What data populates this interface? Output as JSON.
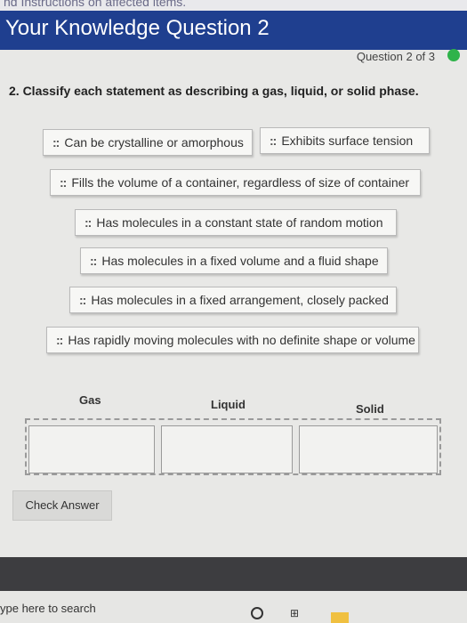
{
  "top_strip_text": "nd Instructions on affected items.",
  "header": {
    "title": "Your Knowledge Question 2"
  },
  "question_counter": "Question 2 of 3",
  "question_text": "2. Classify each statement as describing a gas, liquid, or solid phase.",
  "drag_items": [
    "Can be crystalline or amorphous",
    "Exhibits surface tension",
    "Fills the volume of a container, regardless of size of container",
    "Has molecules in a constant state of random motion",
    "Has molecules in a fixed volume and a fluid shape",
    "Has molecules in a fixed arrangement, closely packed",
    "Has rapidly moving molecules with no definite shape or volume"
  ],
  "grip_glyph": "::",
  "categories": [
    "Gas",
    "Liquid",
    "Solid"
  ],
  "check_answer_label": "Check Answer",
  "taskbar": {
    "search_placeholder": "ype here to search"
  },
  "colors": {
    "header_bg": "#1f3f8f",
    "status_dot": "#2fb34a"
  }
}
